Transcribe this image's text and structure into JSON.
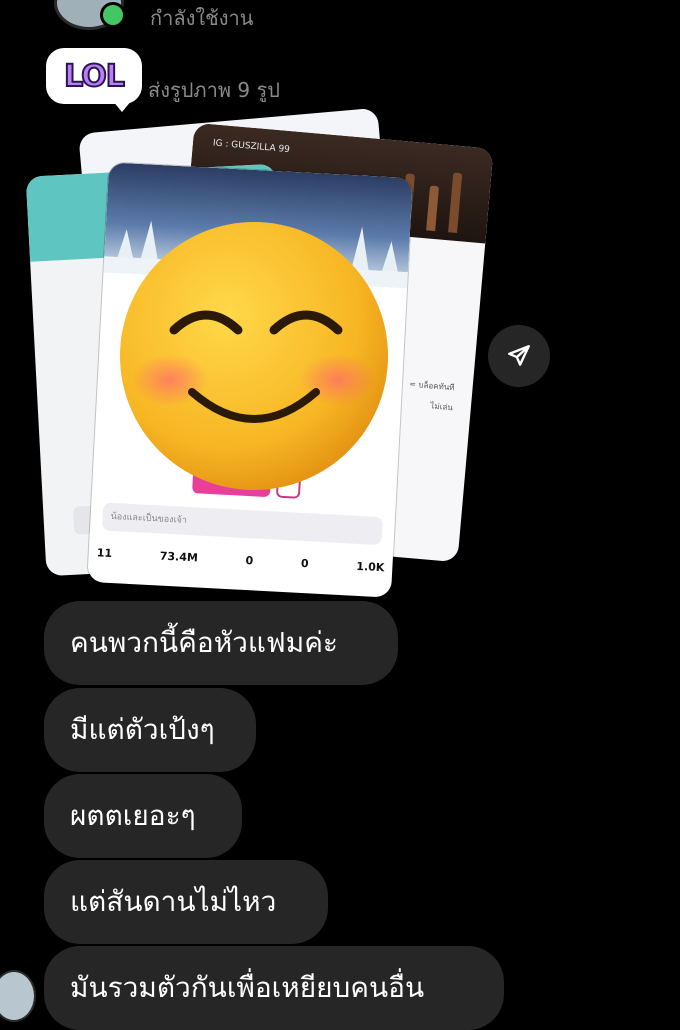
{
  "header": {
    "status": "กำลังใช้งาน"
  },
  "sticker": {
    "text": "LOL"
  },
  "photos": {
    "sent_label": "ส่งรูปภาพ 9 รูป",
    "ig_label": "IG : GUSZILLA 99",
    "side_text_1": "= บล็อคทันที",
    "side_text_2": "ไม่เล่น",
    "input_placeholder": "น้องและเป็นของเจ้า",
    "stats": [
      "11",
      "73.4M",
      "0",
      "0",
      "1.0K"
    ]
  },
  "messages": [
    {
      "text": "คนพวกนี้คือหัวแฟมค่ะ"
    },
    {
      "text": "มีแต่ตัวเป้งๆ"
    },
    {
      "text": "ผตตเยอะๆ"
    },
    {
      "text": "แต่สันดานไม่ไหว"
    },
    {
      "text": "มันรวมตัวกันเพื่อเหยียบคนอื่น"
    }
  ],
  "icons": {
    "share": "share-icon",
    "emoji": "smiling-face-emoji-icon"
  },
  "colors": {
    "background": "#000000",
    "bubble": "#262626",
    "online": "#44c763",
    "muted_text": "#8a8a8a"
  }
}
